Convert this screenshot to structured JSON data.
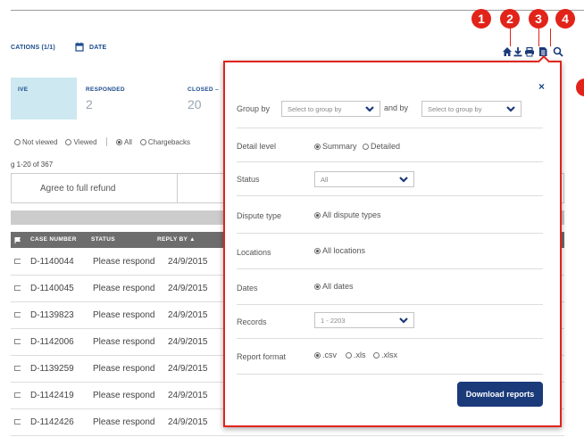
{
  "callouts": [
    "1",
    "2",
    "3",
    "4"
  ],
  "filter_bar": {
    "locations": "CATIONS (1/1)",
    "date": "DATE"
  },
  "tiles": [
    {
      "label": "IVE",
      "count": ""
    },
    {
      "label": "RESPONDED",
      "count": "2"
    },
    {
      "label": "CLOSED –",
      "count": "20"
    }
  ],
  "view_filters": {
    "not_viewed": "Not viewed",
    "viewed": "Viewed",
    "all": "All",
    "chargebacks": "Chargebacks"
  },
  "range": "g 1-20 of 367",
  "action": "Agree to full refund",
  "table": {
    "headers": {
      "case": "CASE NUMBER",
      "status": "STATUS",
      "reply": "REPLY BY ▲"
    },
    "rows": [
      {
        "case": "D-1140044",
        "status": "Please respond",
        "reply": "24/9/2015"
      },
      {
        "case": "D-1140045",
        "status": "Please respond",
        "reply": "24/9/2015"
      },
      {
        "case": "D-1139823",
        "status": "Please respond",
        "reply": "24/9/2015"
      },
      {
        "case": "D-1142006",
        "status": "Please respond",
        "reply": "24/9/2015"
      },
      {
        "case": "D-1139259",
        "status": "Please respond",
        "reply": "24/9/2015"
      },
      {
        "case": "D-1142419",
        "status": "Please respond",
        "reply": "24/9/2015"
      },
      {
        "case": "D-1142426",
        "status": "Please respond",
        "reply": "24/9/2015"
      }
    ]
  },
  "panel": {
    "close": "×",
    "group_by": {
      "label": "Group by",
      "select1": "Select to group by",
      "and_by": "and by",
      "select2": "Select to group by"
    },
    "detail_level": {
      "label": "Detail level",
      "summary": "Summary",
      "detailed": "Detailed"
    },
    "status": {
      "label": "Status",
      "value": "All"
    },
    "dispute_type": {
      "label": "Dispute type",
      "value": "All dispute types"
    },
    "locations": {
      "label": "Locations",
      "value": "All locations"
    },
    "dates": {
      "label": "Dates",
      "value": "All dates"
    },
    "records": {
      "label": "Records",
      "value": "1 - 2203"
    },
    "report_format": {
      "label": "Report format",
      "csv": ".csv",
      "xls": ".xls",
      "xlsx": ".xlsx"
    },
    "download": "Download reports"
  },
  "colors": {
    "accent_red": "#e2231a",
    "brand_blue": "#1a3a7a",
    "header_gray": "#6d6d6d"
  }
}
